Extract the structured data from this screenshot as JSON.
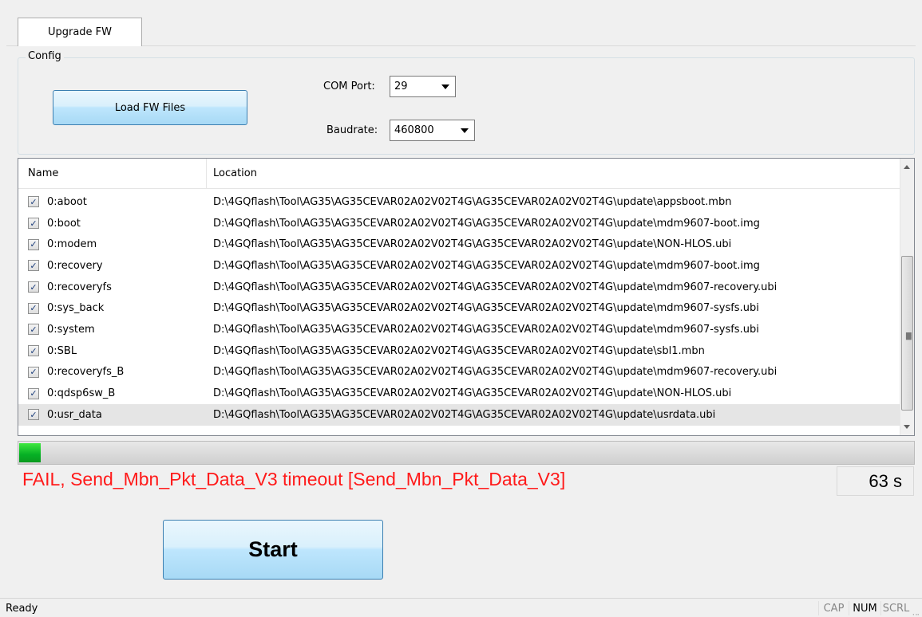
{
  "tab": {
    "label": "Upgrade FW"
  },
  "config": {
    "legend": "Config",
    "load_button": "Load FW Files",
    "com_port_label": "COM Port:",
    "com_port_value": "29",
    "baudrate_label": "Baudrate:",
    "baudrate_value": "460800"
  },
  "list": {
    "columns": [
      "Name",
      "Location"
    ],
    "rows": [
      {
        "checked": true,
        "name": "0:aboot",
        "location": "D:\\4GQflash\\Tool\\AG35\\AG35CEVAR02A02V02T4G\\AG35CEVAR02A02V02T4G\\update\\appsboot.mbn"
      },
      {
        "checked": true,
        "name": "0:boot",
        "location": "D:\\4GQflash\\Tool\\AG35\\AG35CEVAR02A02V02T4G\\AG35CEVAR02A02V02T4G\\update\\mdm9607-boot.img"
      },
      {
        "checked": true,
        "name": "0:modem",
        "location": "D:\\4GQflash\\Tool\\AG35\\AG35CEVAR02A02V02T4G\\AG35CEVAR02A02V02T4G\\update\\NON-HLOS.ubi"
      },
      {
        "checked": true,
        "name": "0:recovery",
        "location": "D:\\4GQflash\\Tool\\AG35\\AG35CEVAR02A02V02T4G\\AG35CEVAR02A02V02T4G\\update\\mdm9607-boot.img"
      },
      {
        "checked": true,
        "name": "0:recoveryfs",
        "location": "D:\\4GQflash\\Tool\\AG35\\AG35CEVAR02A02V02T4G\\AG35CEVAR02A02V02T4G\\update\\mdm9607-recovery.ubi"
      },
      {
        "checked": true,
        "name": "0:sys_back",
        "location": "D:\\4GQflash\\Tool\\AG35\\AG35CEVAR02A02V02T4G\\AG35CEVAR02A02V02T4G\\update\\mdm9607-sysfs.ubi"
      },
      {
        "checked": true,
        "name": "0:system",
        "location": "D:\\4GQflash\\Tool\\AG35\\AG35CEVAR02A02V02T4G\\AG35CEVAR02A02V02T4G\\update\\mdm9607-sysfs.ubi"
      },
      {
        "checked": true,
        "name": "0:SBL",
        "location": "D:\\4GQflash\\Tool\\AG35\\AG35CEVAR02A02V02T4G\\AG35CEVAR02A02V02T4G\\update\\sbl1.mbn"
      },
      {
        "checked": true,
        "name": "0:recoveryfs_B",
        "location": "D:\\4GQflash\\Tool\\AG35\\AG35CEVAR02A02V02T4G\\AG35CEVAR02A02V02T4G\\update\\mdm9607-recovery.ubi"
      },
      {
        "checked": true,
        "name": "0:qdsp6sw_B",
        "location": "D:\\4GQflash\\Tool\\AG35\\AG35CEVAR02A02V02T4G\\AG35CEVAR02A02V02T4G\\update\\NON-HLOS.ubi"
      },
      {
        "checked": true,
        "name": "0:usr_data",
        "location": "D:\\4GQflash\\Tool\\AG35\\AG35CEVAR02A02V02T4G\\AG35CEVAR02A02V02T4G\\update\\usrdata.ubi"
      }
    ],
    "selected_index": 10
  },
  "progress": {
    "percent": 2.4,
    "color": "#06b025"
  },
  "status": {
    "message": "FAIL, Send_Mbn_Pkt_Data_V3 timeout [Send_Mbn_Pkt_Data_V3]",
    "message_color": "#ff1a1a",
    "elapsed": "63 s"
  },
  "start_button": "Start",
  "statusbar": {
    "text": "Ready",
    "indicators": [
      {
        "label": "CAP",
        "active": false
      },
      {
        "label": "NUM",
        "active": true
      },
      {
        "label": "SCRL",
        "active": false
      }
    ]
  }
}
